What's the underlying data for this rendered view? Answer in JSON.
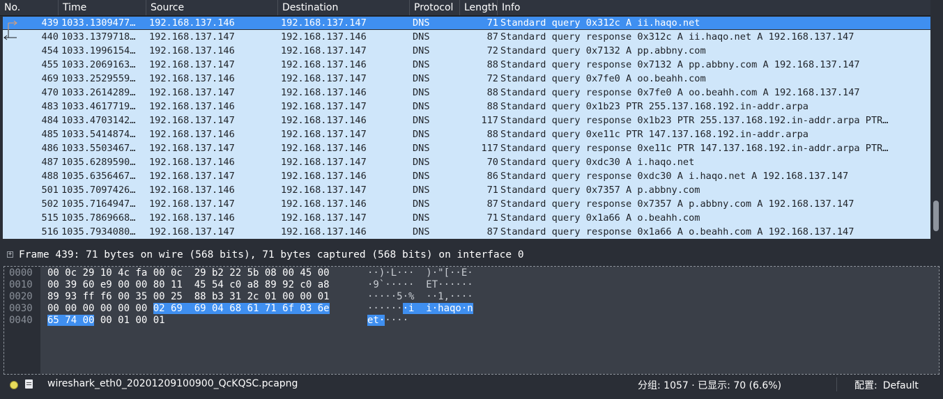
{
  "columns": {
    "no": "No.",
    "time": "Time",
    "source": "Source",
    "destination": "Destination",
    "protocol": "Protocol",
    "length": "Length",
    "info": "Info"
  },
  "packets": [
    {
      "no": "439",
      "time": "1033.1309477…",
      "source": "192.168.137.146",
      "destination": "192.168.137.147",
      "protocol": "DNS",
      "length": "71",
      "info": "Standard query 0x312c A ii.haqo.net",
      "selected": true,
      "related": "request"
    },
    {
      "no": "440",
      "time": "1033.1379718…",
      "source": "192.168.137.147",
      "destination": "192.168.137.146",
      "protocol": "DNS",
      "length": "87",
      "info": "Standard query response 0x312c A ii.haqo.net A 192.168.137.147",
      "related": "response"
    },
    {
      "no": "454",
      "time": "1033.1996154…",
      "source": "192.168.137.146",
      "destination": "192.168.137.147",
      "protocol": "DNS",
      "length": "72",
      "info": "Standard query 0x7132 A pp.abbny.com"
    },
    {
      "no": "455",
      "time": "1033.2069163…",
      "source": "192.168.137.147",
      "destination": "192.168.137.146",
      "protocol": "DNS",
      "length": "88",
      "info": "Standard query response 0x7132 A pp.abbny.com A 192.168.137.147"
    },
    {
      "no": "469",
      "time": "1033.2529559…",
      "source": "192.168.137.146",
      "destination": "192.168.137.147",
      "protocol": "DNS",
      "length": "72",
      "info": "Standard query 0x7fe0 A oo.beahh.com"
    },
    {
      "no": "470",
      "time": "1033.2614289…",
      "source": "192.168.137.147",
      "destination": "192.168.137.146",
      "protocol": "DNS",
      "length": "88",
      "info": "Standard query response 0x7fe0 A oo.beahh.com A 192.168.137.147"
    },
    {
      "no": "483",
      "time": "1033.4617719…",
      "source": "192.168.137.146",
      "destination": "192.168.137.147",
      "protocol": "DNS",
      "length": "88",
      "info": "Standard query 0x1b23 PTR 255.137.168.192.in-addr.arpa"
    },
    {
      "no": "484",
      "time": "1033.4703142…",
      "source": "192.168.137.147",
      "destination": "192.168.137.146",
      "protocol": "DNS",
      "length": "117",
      "info": "Standard query response 0x1b23 PTR 255.137.168.192.in-addr.arpa PTR…"
    },
    {
      "no": "485",
      "time": "1033.5414874…",
      "source": "192.168.137.146",
      "destination": "192.168.137.147",
      "protocol": "DNS",
      "length": "88",
      "info": "Standard query 0xe11c PTR 147.137.168.192.in-addr.arpa"
    },
    {
      "no": "486",
      "time": "1033.5503467…",
      "source": "192.168.137.147",
      "destination": "192.168.137.146",
      "protocol": "DNS",
      "length": "117",
      "info": "Standard query response 0xe11c PTR 147.137.168.192.in-addr.arpa PTR…"
    },
    {
      "no": "487",
      "time": "1035.6289590…",
      "source": "192.168.137.146",
      "destination": "192.168.137.147",
      "protocol": "DNS",
      "length": "70",
      "info": "Standard query 0xdc30 A i.haqo.net"
    },
    {
      "no": "488",
      "time": "1035.6356467…",
      "source": "192.168.137.147",
      "destination": "192.168.137.146",
      "protocol": "DNS",
      "length": "86",
      "info": "Standard query response 0xdc30 A i.haqo.net A 192.168.137.147"
    },
    {
      "no": "501",
      "time": "1035.7097426…",
      "source": "192.168.137.146",
      "destination": "192.168.137.147",
      "protocol": "DNS",
      "length": "71",
      "info": "Standard query 0x7357 A p.abbny.com"
    },
    {
      "no": "502",
      "time": "1035.7164947…",
      "source": "192.168.137.147",
      "destination": "192.168.137.146",
      "protocol": "DNS",
      "length": "87",
      "info": "Standard query response 0x7357 A p.abbny.com A 192.168.137.147"
    },
    {
      "no": "515",
      "time": "1035.7869668…",
      "source": "192.168.137.146",
      "destination": "192.168.137.147",
      "protocol": "DNS",
      "length": "71",
      "info": "Standard query 0x1a66 A o.beahh.com"
    },
    {
      "no": "516",
      "time": "1035.7934080…",
      "source": "192.168.137.147",
      "destination": "192.168.137.146",
      "protocol": "DNS",
      "length": "87",
      "info": "Standard query response 0x1a66 A o.beahh.com A 192.168.137.147"
    }
  ],
  "detail": {
    "expander": "+",
    "frame_summary": "Frame 439: 71 bytes on wire (568 bits), 71 bytes captured (568 bits) on interface 0"
  },
  "bytes": [
    {
      "offset": "0000",
      "hex_plain": "00 0c 29 10 4c fa 00 0c  29 b2 22 5b 08 00 45 00",
      "hex_hl": "",
      "hex_tail": "",
      "ascii_plain": "··)·L···  )·\"[··E·",
      "ascii_hl": "",
      "ascii_tail": ""
    },
    {
      "offset": "0010",
      "hex_plain": "00 39 60 e9 00 00 80 11  45 54 c0 a8 89 92 c0 a8",
      "hex_hl": "",
      "hex_tail": "",
      "ascii_plain": "·9`·····  ET······",
      "ascii_hl": "",
      "ascii_tail": ""
    },
    {
      "offset": "0020",
      "hex_plain": "89 93 ff f6 00 35 00 25  88 b3 31 2c 01 00 00 01",
      "hex_hl": "",
      "hex_tail": "",
      "ascii_plain": "·····5·%  ··1,····",
      "ascii_hl": "",
      "ascii_tail": ""
    },
    {
      "offset": "0030",
      "hex_plain": "00 00 00 00 00 00 ",
      "hex_hl": "02 69  69 04 68 61 71 6f 03 6e",
      "hex_tail": "",
      "ascii_plain": "······",
      "ascii_hl": "·i  i·haqo·n",
      "ascii_tail": ""
    },
    {
      "offset": "0040",
      "hex_plain": "",
      "hex_hl": "65 74 00",
      "hex_tail": " 00 01 00 01",
      "ascii_plain": "",
      "ascii_hl": "et·",
      "ascii_tail": "····"
    }
  ],
  "status": {
    "file_name": "wireshark_eth0_20201209100900_QcKQSC.pcapng",
    "packet_stats": "分组: 1057 · 已显示: 70 (6.6%)",
    "profile_label": "配置:",
    "profile_value": "Default"
  },
  "colors": {
    "row_bg": "#cfe6fa",
    "selected_bg": "#3f8ff0",
    "window_bg": "#2a2e36"
  }
}
